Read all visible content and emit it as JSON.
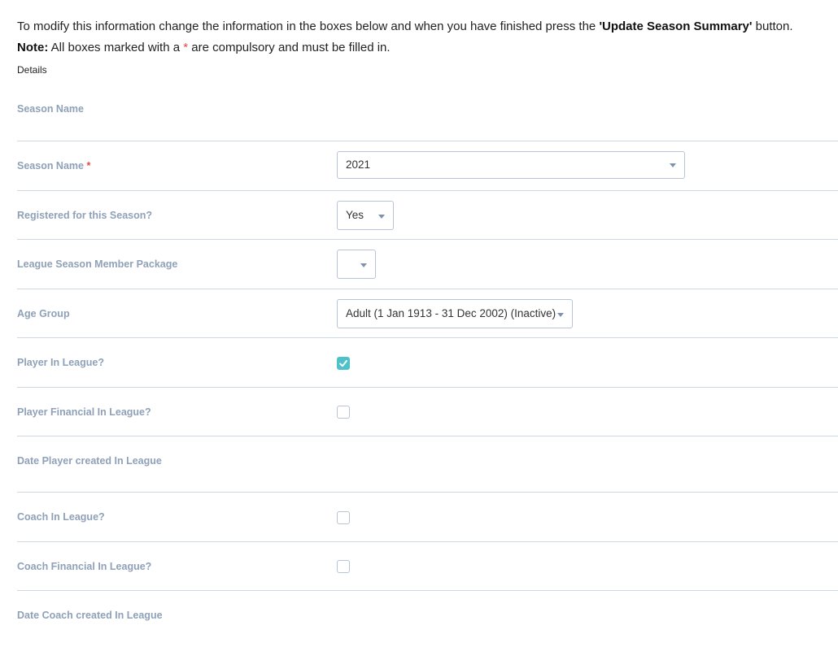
{
  "intro": {
    "line1_prefix": "To modify this information change the information in the boxes below and when you have finished press the ",
    "line1_bold": "'Update Season Summary'",
    "line1_suffix": " button.",
    "note_label": "Note:",
    "note_prefix": " All boxes marked with a ",
    "note_star": "*",
    "note_suffix": " are compulsory and must be filled in."
  },
  "details_label": "Details",
  "section_title": "Season Name",
  "fields": {
    "season_name": {
      "label": "Season Name",
      "required_mark": "*",
      "value": "2021"
    },
    "registered": {
      "label": "Registered for this Season?",
      "value": "Yes"
    },
    "member_package": {
      "label": "League Season Member Package",
      "value": ""
    },
    "age_group": {
      "label": "Age Group",
      "value": "Adult (1 Jan 1913 - 31 Dec 2002) (Inactive)"
    },
    "player_in_league": {
      "label": "Player In League?",
      "checked": true
    },
    "player_financial": {
      "label": "Player Financial In League?",
      "checked": false
    },
    "date_player_created": {
      "label": "Date Player created In League"
    },
    "coach_in_league": {
      "label": "Coach In League?",
      "checked": false
    },
    "coach_financial": {
      "label": "Coach Financial In League?",
      "checked": false
    },
    "date_coach_created": {
      "label": "Date Coach created In League"
    }
  },
  "colors": {
    "label": "#8fa1b8",
    "divider": "#cfd7e1",
    "required": "#e04a4a",
    "checkbox_checked": "#4ec2c9"
  }
}
